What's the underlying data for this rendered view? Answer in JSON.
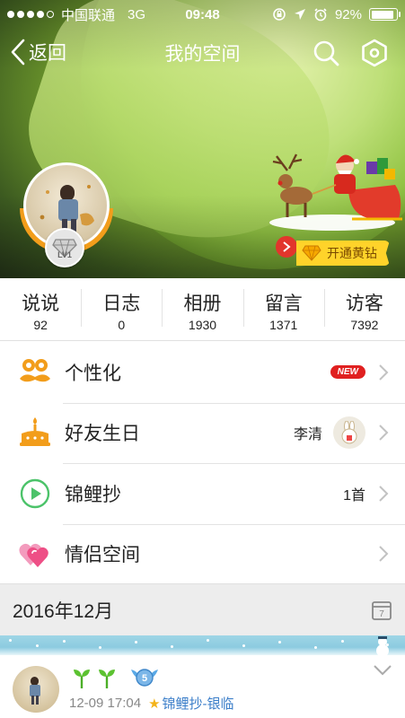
{
  "status_bar": {
    "carrier": "中国联通",
    "network": "3G",
    "time": "09:48",
    "battery": "92%",
    "battery_level": 0.92
  },
  "nav": {
    "back_label": "返回",
    "title": "我的空间"
  },
  "profile": {
    "level_badge": "LV1",
    "yellow_diamond_cta": "开通黄钻"
  },
  "stats": [
    {
      "label": "说说",
      "count": "92"
    },
    {
      "label": "日志",
      "count": "0"
    },
    {
      "label": "相册",
      "count": "1930"
    },
    {
      "label": "留言",
      "count": "1371"
    },
    {
      "label": "访客",
      "count": "7392"
    }
  ],
  "menu": [
    {
      "label": "个性化",
      "badge": "NEW",
      "icon": "mustache-icon"
    },
    {
      "label": "好友生日",
      "detail": "李清",
      "icon": "cake-icon"
    },
    {
      "label": "锦鲤抄",
      "detail": "1首",
      "icon": "play-icon"
    },
    {
      "label": "情侣空间",
      "icon": "hearts-icon"
    }
  ],
  "feed": {
    "month": "2016年12月",
    "calendar_day": "7",
    "post": {
      "time": "12-09 17:04",
      "song": "锦鲤抄-银临",
      "vip_badge": "5"
    }
  },
  "colors": {
    "accent_orange": "#f29d1b",
    "diamond_yellow": "#ffd32a",
    "new_red": "#e02020",
    "link_blue": "#3b7ec9",
    "play_green": "#4cc36a",
    "heart_pink": "#ee4f86"
  }
}
